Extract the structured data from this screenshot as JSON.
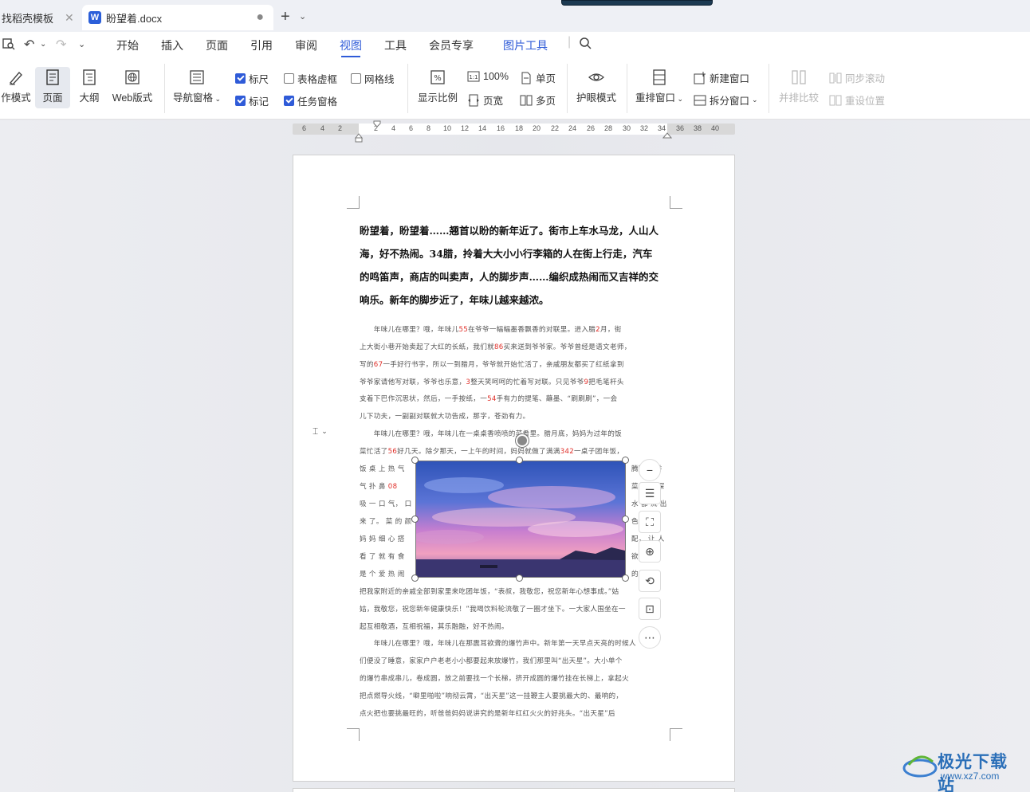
{
  "tabs": [
    {
      "label": "找稻壳模板"
    },
    {
      "label": "盼望着.docx"
    }
  ],
  "doc_badge": "W",
  "menu": [
    "开始",
    "插入",
    "页面",
    "引用",
    "审阅",
    "视图",
    "工具",
    "会员专享",
    "图片工具"
  ],
  "ribbon": {
    "write_mode": "作模式",
    "page": "页面",
    "outline": "大纲",
    "web": "Web版式",
    "nav_pane": "导航窗格",
    "ruler": "标尺",
    "mark": "标记",
    "table_gridlines": "表格虚框",
    "task_pane": "任务窗格",
    "gridlines": "网格线",
    "zoom": "显示比例",
    "zoom100": "100%",
    "page_width": "页宽",
    "single_page": "单页",
    "multi_page": "多页",
    "eye_mode": "护眼模式",
    "rearrange": "重排窗口",
    "new_window": "新建窗口",
    "split_window": "拆分窗口",
    "side_by_side": "并排比较",
    "sync_scroll": "同步滚动",
    "reset_pos": "重设位置"
  },
  "ruler_numbers": [
    "6",
    "4",
    "2",
    "2",
    "4",
    "6",
    "8",
    "10",
    "12",
    "14",
    "16",
    "18",
    "20",
    "22",
    "24",
    "26",
    "28",
    "30",
    "32",
    "34",
    "36",
    "38",
    "40"
  ],
  "document": {
    "bold_lines": [
      "盼望着，盼望着……翘首以盼的新年近了。街市上车水马龙，人山人",
      "海，好不热闹。34腊，拎着大大小小行李箱的人在街上行走，汽车",
      "的鸣笛声，商店的叫卖声，人的脚步声……编织成热闹而又吉祥的交",
      "响乐。新年的脚步近了，年味儿越来越浓。"
    ],
    "p1": [
      {
        "a": "　　年味儿在哪里？哦，年味儿",
        "n": "55",
        "b": "在爷爷一幅幅墨香飘香的对联里。进入腊",
        "n2": "2",
        "c": "月，街"
      },
      {
        "a": "上大街小巷开始卖起了大红的长纸，我们就",
        "n": "86",
        "b": "买来送到爷爷家。爷爷曾经是语文老师，",
        "n2": "",
        "c": ""
      },
      {
        "a": "写的",
        "n": "67",
        "b": "一手好行书字，所以一到腊月，爷爷就开始忙活了，亲戚朋友都买了红纸拿到",
        "n2": "",
        "c": ""
      },
      {
        "a": "爷爷家请他写对联，爷爷也乐意，",
        "n": "3",
        "b": "整天笑呵呵的忙着写对联。只见爷爷",
        "n2": "9",
        "c": "把毛笔杆头"
      },
      {
        "a": "支着下巴作沉思状，然后，一手按纸，一",
        "n": "54",
        "b": "手有力的提笔、蘸墨、“刷刷刷”，一会",
        "n2": "",
        "c": ""
      },
      {
        "a": "儿下功夫，一副副对联就大功告成，那字，苍劲有力。",
        "n": "",
        "b": "",
        "n2": "",
        "c": ""
      }
    ],
    "p2_top": [
      {
        "a": "　　年味儿在哪里？哦，年味儿在一桌桌香喷喷的菜肴里。腊月底，妈妈为过年的饭",
        "n": "",
        "b": ""
      },
      {
        "a": "菜忙活了",
        "n": "56",
        "b": "好几天。除夕那天，一上午的时间，妈妈就做了满满",
        "n2": "342",
        "c": "一桌子团年饭，"
      }
    ],
    "p2_left": [
      "饭 桌 上 热 气",
      "气 扑 鼻",
      "吸 一 口 气， 口",
      "来 了。 菜 的 颜",
      "妈 妈 细 心 搭",
      "看 了 就 有 食",
      "是 个 爱 热 闹"
    ],
    "p2_left_num": "08",
    "p2_right": [
      "腾腾， 香",
      "菜， 菜 深",
      "水 都 流 出",
      "色 香 过",
      "配， 让 人",
      "欲 爸 爸",
      "的 他"
    ],
    "p2_bottom": [
      "把我家附近的亲戚全部到家里来吃团年饭，“表叔，我敬您，祝您新年心想事成。”姑",
      "姑，我敬您，祝您新年健康快乐！”我喝饮料轮流敬了一圈才坐下。一大家人围坐在一",
      "起互相敬酒，互相祝福，其乐融融，好不热闹。"
    ],
    "p3": [
      "　　年味儿在哪里？哦，年味儿在那震耳欲聋的爆竹声中。新年第一天早点天亮的时候人",
      "们便没了睡意，家家户户老老小小都要起来放爆竹，我们那里叫“出天星”。大小单个",
      "的爆竹串成串儿，卷成圆，放之前要找一个长梯，挤开成圆的爆竹挂在长梯上，拿起火",
      "把点燃导火线，“噼里啪啦”响彻云霄，“出天星”这一挂鞭主人要挑最大的、最响的，",
      "点火把也要挑最旺的，听爸爸妈妈说讲究的是新年红红火火的好兆头。“出天星”后"
    ]
  },
  "watermark": {
    "title": "极光下载站",
    "url": "www.xz7.com"
  }
}
